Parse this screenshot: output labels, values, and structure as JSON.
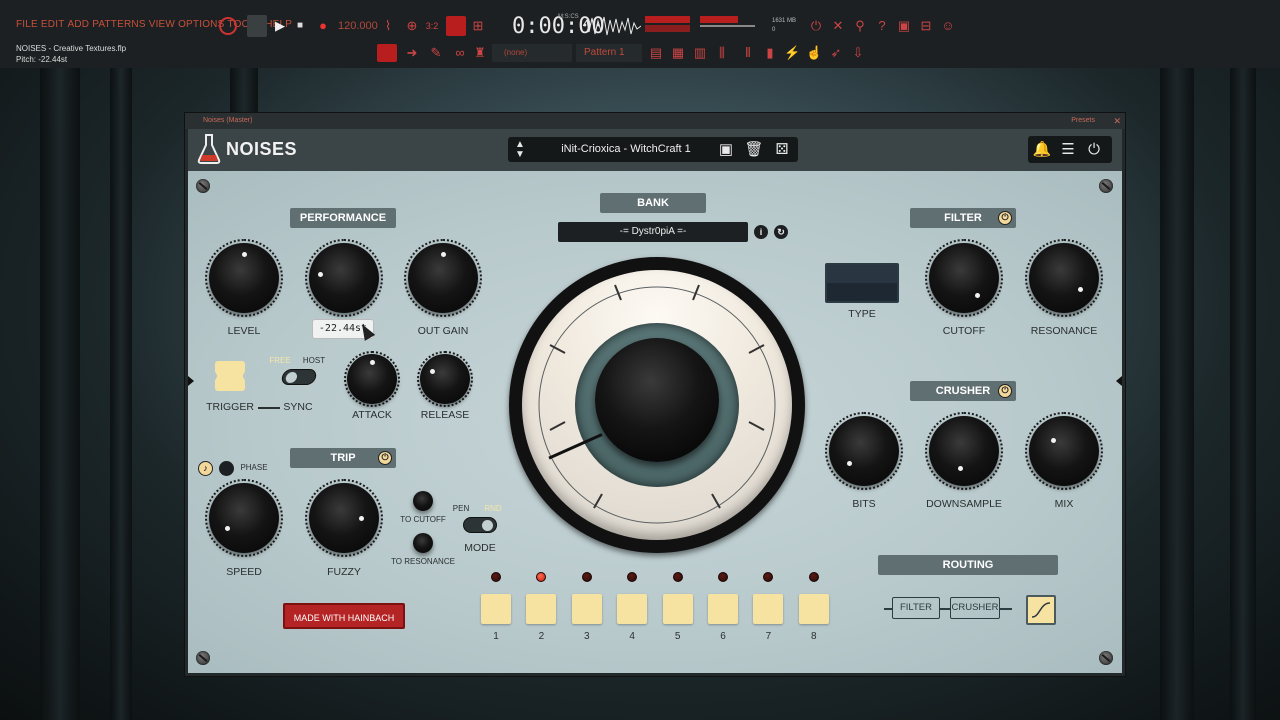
{
  "host": {
    "menu": [
      "FILE",
      "EDIT",
      "ADD",
      "PATTERNS",
      "VIEW",
      "OPTIONS",
      "TOOLS",
      "HELP"
    ],
    "file_name": "NOISES - Creative Textures.flp",
    "hint": "Pitch: -22.44st",
    "time": "0:00:00",
    "time_label": "M:S:CS",
    "tempo": "120.000",
    "memory": "1631 MB",
    "memory_sub": "0",
    "pattern": "Pattern 1",
    "channel": "(none)"
  },
  "window": {
    "title": "Noises (Master)",
    "presets_label": "Presets"
  },
  "header": {
    "logo": "NOISES",
    "preset": "iNit-Crioxica - WitchCraft 1"
  },
  "performance": {
    "title": "PERFORMANCE",
    "knobs": [
      {
        "label": "LEVEL",
        "value": 0.5
      },
      {
        "label": "",
        "value": 0.2
      },
      {
        "label": "OUT GAIN",
        "value": 0.5
      }
    ],
    "tooltip": "-22.44st",
    "trigger_label": "TRIGGER",
    "sync_label": "SYNC",
    "sync_free": "FREE",
    "sync_host": "HOST",
    "attack_label": "ATTACK",
    "release_label": "RELEASE"
  },
  "trip": {
    "title": "TRIP",
    "phase_label": "PHASE",
    "speed_label": "SPEED",
    "fuzzy_label": "FUZZY",
    "to_cutoff": "TO CUTOFF",
    "to_resonance": "TO RESONANCE",
    "mode_label": "MODE",
    "mode_pen": "PEN",
    "mode_rnd": "RND"
  },
  "made_with": "MADE WITH HAINBACH",
  "bank": {
    "title": "BANK",
    "name": "-= Dystr0piA =-"
  },
  "filter": {
    "title": "FILTER",
    "type_label": "TYPE",
    "cutoff_label": "CUTOFF",
    "resonance_label": "RESONANCE"
  },
  "crusher": {
    "title": "CRUSHER",
    "bits_label": "BITS",
    "downsample_label": "DOWNSAMPLE",
    "mix_label": "MIX"
  },
  "routing": {
    "title": "ROUTING",
    "filter": "FILTER",
    "crusher": "CRUSHER"
  },
  "steps": {
    "numbers": [
      "1",
      "2",
      "3",
      "4",
      "5",
      "6",
      "7",
      "8"
    ],
    "active_index": 1
  },
  "colors": {
    "accent_red": "#b42424",
    "pad_cream": "#f7e3a1",
    "panel": "#b8c9cc"
  }
}
